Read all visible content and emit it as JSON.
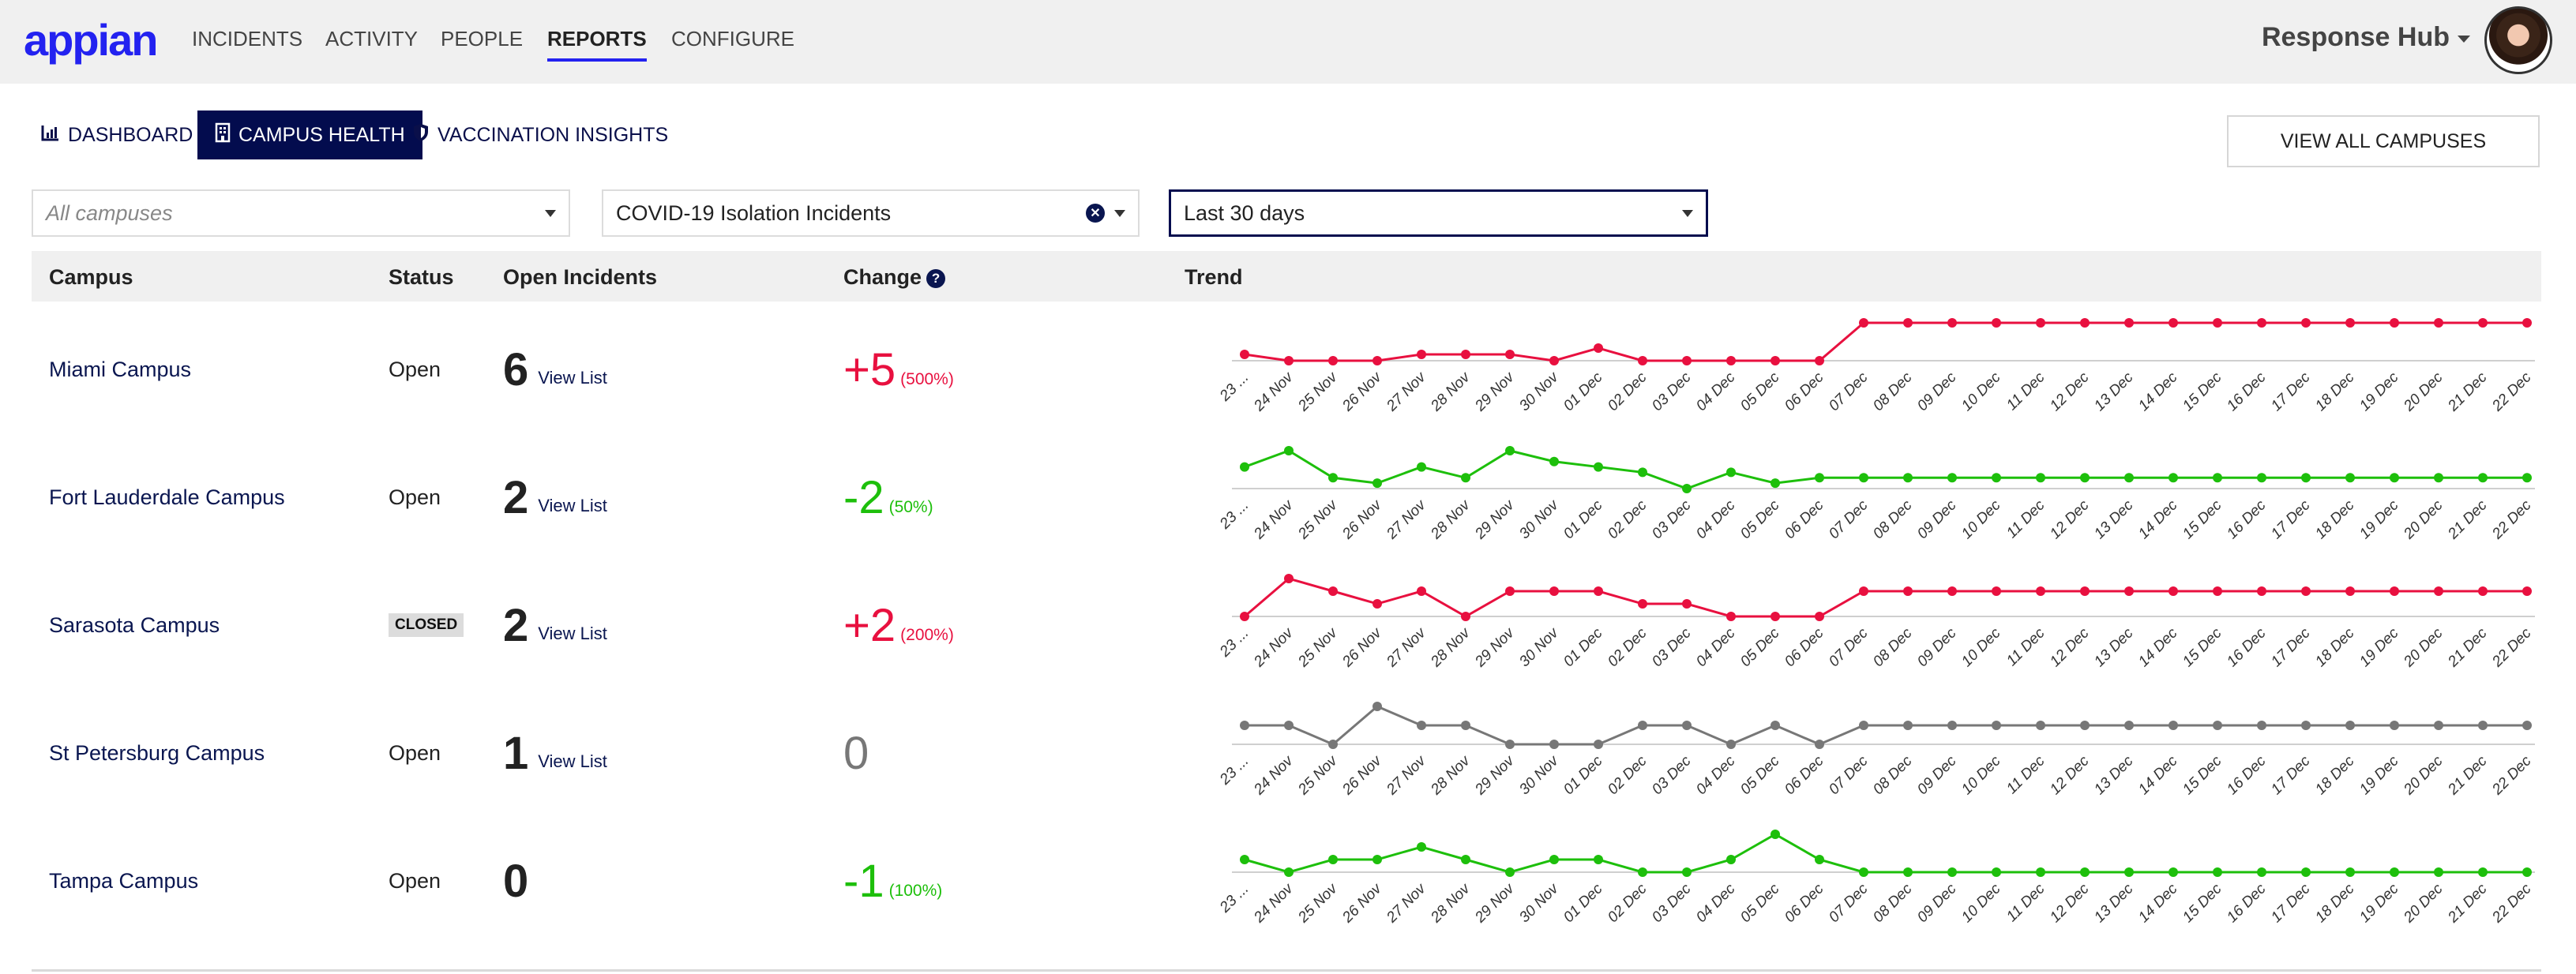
{
  "header": {
    "logo": "appian",
    "nav": [
      "INCIDENTS",
      "ACTIVITY",
      "PEOPLE",
      "REPORTS",
      "CONFIGURE"
    ],
    "active_nav": "REPORTS",
    "app_name": "Response Hub",
    "accent_color": "#2322f0"
  },
  "tabs": [
    {
      "label": "DASHBOARD",
      "icon": "bar-chart-icon",
      "active": false
    },
    {
      "label": "CAMPUS HEALTH",
      "icon": "building-icon",
      "active": true
    },
    {
      "label": "VACCINATION INSIGHTS",
      "icon": "shield-icon",
      "active": false
    }
  ],
  "view_all_label": "VIEW ALL CAMPUSES",
  "filters": {
    "campus": {
      "placeholder": "All campuses",
      "value": ""
    },
    "incident_type": {
      "value": "COVID-19 Isolation Incidents"
    },
    "period": {
      "value": "Last 30 days"
    }
  },
  "table": {
    "columns": [
      "Campus",
      "Status",
      "Open Incidents",
      "Change",
      "Trend"
    ],
    "view_list_label": "View List",
    "rows": [
      {
        "campus": "Miami Campus",
        "status": "Open",
        "closed": false,
        "open_incidents": "6",
        "has_list": true,
        "change": "+5",
        "change_pct": "(500%)",
        "direction": "up"
      },
      {
        "campus": "Fort Lauderdale Campus",
        "status": "Open",
        "closed": false,
        "open_incidents": "2",
        "has_list": true,
        "change": "-2",
        "change_pct": "(50%)",
        "direction": "down"
      },
      {
        "campus": "Sarasota Campus",
        "status": "CLOSED",
        "closed": true,
        "open_incidents": "2",
        "has_list": true,
        "change": "+2",
        "change_pct": "(200%)",
        "direction": "up"
      },
      {
        "campus": "St Petersburg Campus",
        "status": "Open",
        "closed": false,
        "open_incidents": "1",
        "has_list": true,
        "change": "0",
        "change_pct": "",
        "direction": "flat"
      },
      {
        "campus": "Tampa Campus",
        "status": "Open",
        "closed": false,
        "open_incidents": "0",
        "has_list": false,
        "change": "-1",
        "change_pct": "(100%)",
        "direction": "down"
      }
    ]
  },
  "colors": {
    "up": "#e8103f",
    "down": "#1dbf0b",
    "flat": "#777777",
    "link": "#0a1650"
  },
  "chart_data": {
    "type": "line",
    "title": "Trend",
    "x": [
      "23 ...",
      "24 Nov",
      "25 Nov",
      "26 Nov",
      "27 Nov",
      "28 Nov",
      "29 Nov",
      "30 Nov",
      "01 Dec",
      "02 Dec",
      "03 Dec",
      "04 Dec",
      "05 Dec",
      "06 Dec",
      "07 Dec",
      "08 Dec",
      "09 Dec",
      "10 Dec",
      "11 Dec",
      "12 Dec",
      "13 Dec",
      "14 Dec",
      "15 Dec",
      "16 Dec",
      "17 Dec",
      "18 Dec",
      "19 Dec",
      "20 Dec",
      "21 Dec",
      "22 Dec"
    ],
    "series": [
      {
        "name": "Miami Campus",
        "values": [
          1,
          0,
          0,
          0,
          1,
          1,
          1,
          0,
          2,
          0,
          0,
          0,
          0,
          0,
          6,
          6,
          6,
          6,
          6,
          6,
          6,
          6,
          6,
          6,
          6,
          6,
          6,
          6,
          6,
          6
        ]
      },
      {
        "name": "Fort Lauderdale Campus",
        "values": [
          4,
          7,
          2,
          1,
          4,
          2,
          7,
          5,
          4,
          3,
          0,
          3,
          1,
          2,
          2,
          2,
          2,
          2,
          2,
          2,
          2,
          2,
          2,
          2,
          2,
          2,
          2,
          2,
          2,
          2
        ]
      },
      {
        "name": "Sarasota Campus",
        "values": [
          0,
          3,
          2,
          1,
          2,
          0,
          2,
          2,
          2,
          1,
          1,
          0,
          0,
          0,
          2,
          2,
          2,
          2,
          2,
          2,
          2,
          2,
          2,
          2,
          2,
          2,
          2,
          2,
          2,
          2
        ]
      },
      {
        "name": "St Petersburg Campus",
        "values": [
          1,
          1,
          0,
          2,
          1,
          1,
          0,
          0,
          0,
          1,
          1,
          0,
          1,
          0,
          1,
          1,
          1,
          1,
          1,
          1,
          1,
          1,
          1,
          1,
          1,
          1,
          1,
          1,
          1,
          1
        ]
      },
      {
        "name": "Tampa Campus",
        "values": [
          1,
          0,
          1,
          1,
          2,
          1,
          0,
          1,
          1,
          0,
          0,
          1,
          3,
          1,
          0,
          0,
          0,
          0,
          0,
          0,
          0,
          0,
          0,
          0,
          0,
          0,
          0,
          0,
          0,
          0
        ]
      }
    ],
    "xlabel": "",
    "ylabel": "",
    "grid": false,
    "legend": "none"
  }
}
